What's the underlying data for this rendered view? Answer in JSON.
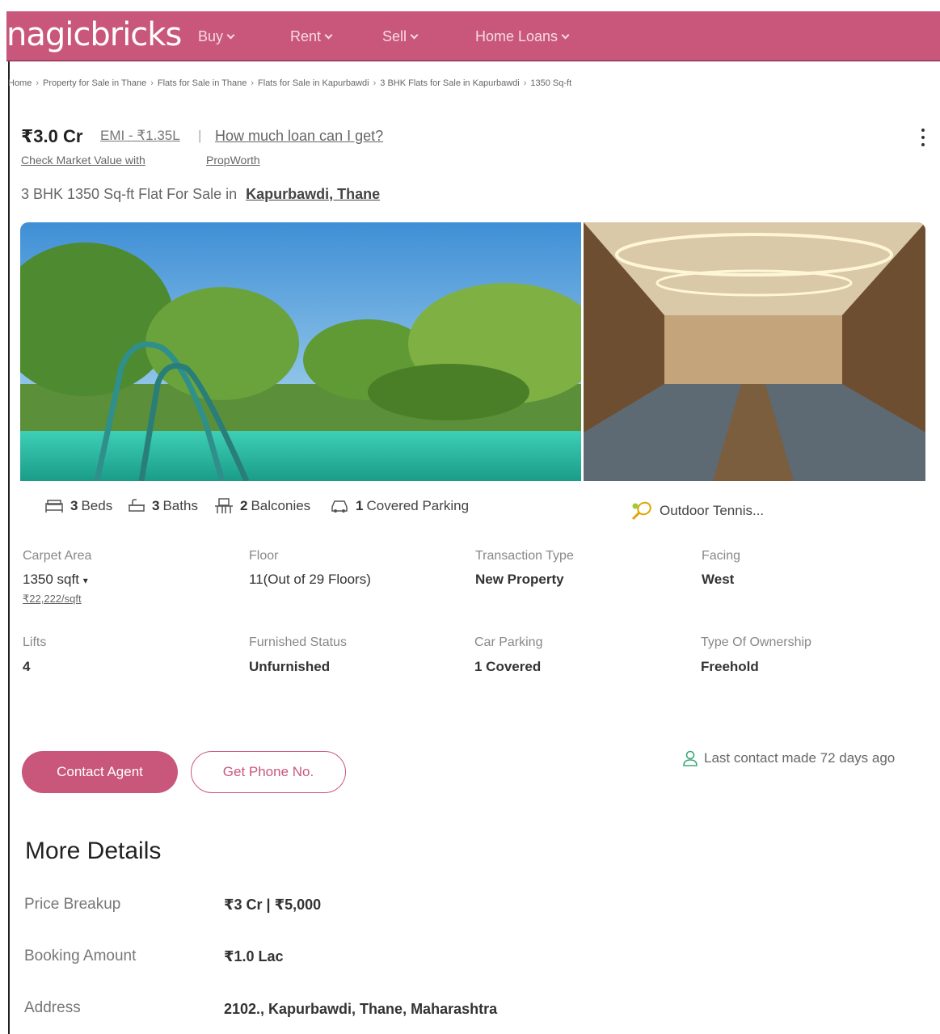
{
  "colors": {
    "brand": "#c9577c",
    "text": "#333333",
    "muted": "#888888"
  },
  "header": {
    "logo": "nagicbricks",
    "nav": [
      {
        "label": "Buy"
      },
      {
        "label": "Rent"
      },
      {
        "label": "Sell"
      },
      {
        "label": "Home Loans"
      }
    ]
  },
  "breadcrumb": [
    "Home",
    "Property for Sale in Thane",
    "Flats for Sale in Thane",
    "Flats for Sale in Kapurbawdi",
    "3 BHK Flats for Sale in Kapurbawdi",
    "1350 Sq-ft"
  ],
  "listing": {
    "price": "₹3.0 Cr",
    "emi": "EMI - ₹1.35L",
    "loan_link": "How much loan can I get?",
    "market_value": "Check Market Value with",
    "propworth": "PropWorth",
    "headline_prefix": "3 BHK 1350 Sq-ft Flat For Sale in",
    "locality": "Kapurbawdi, Thane"
  },
  "amenities": {
    "beds_count": "3",
    "beds_label": "Beds",
    "baths_count": "3",
    "baths_label": "Baths",
    "balconies_count": "2",
    "balconies_label": "Balconies",
    "parking_count": "1",
    "parking_label": "Covered Parking",
    "outdoor": "Outdoor Tennis..."
  },
  "details": {
    "carpet_area_label": "Carpet Area",
    "carpet_area_value": "1350 sqft",
    "price_per_sqft": "₹22,222/sqft",
    "floor_label": "Floor",
    "floor_value": "11(Out of 29 Floors)",
    "transaction_label": "Transaction Type",
    "transaction_value": "New Property",
    "facing_label": "Facing",
    "facing_value": "West",
    "lifts_label": "Lifts",
    "lifts_value": "4",
    "furnished_label": "Furnished Status",
    "furnished_value": "Unfurnished",
    "car_parking_label": "Car Parking",
    "car_parking_value": "1 Covered",
    "ownership_label": "Type Of Ownership",
    "ownership_value": "Freehold"
  },
  "actions": {
    "contact_agent": "Contact Agent",
    "get_phone": "Get Phone No.",
    "last_contact": "Last contact made 72 days ago"
  },
  "more_details": {
    "title": "More Details",
    "rows": [
      {
        "label": "Price Breakup",
        "value": "₹3 Cr | ₹5,000"
      },
      {
        "label": "Booking Amount",
        "value": "₹1.0 Lac"
      },
      {
        "label": "Address",
        "value": "2102., Kapurbawdi, Thane, Maharashtra"
      }
    ]
  }
}
